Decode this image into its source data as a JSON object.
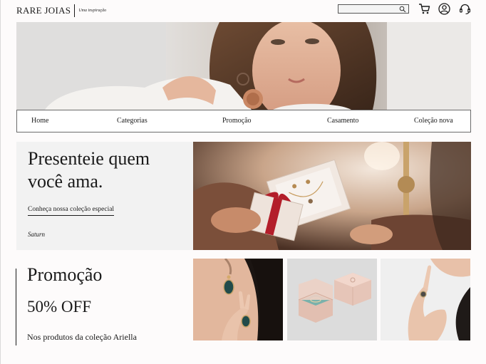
{
  "header": {
    "logo_main": "RARE JOIAS",
    "logo_tagline": "Uma inspiração",
    "search_value": "",
    "icons": [
      "search-icon",
      "cart-icon",
      "user-icon",
      "support-headset-icon"
    ]
  },
  "nav": {
    "items": [
      "Home",
      "Categorias",
      "Promoção",
      "Casamento",
      "Coleção nova"
    ]
  },
  "gift_promo": {
    "title": "Presenteie quem você ama.",
    "link": "Conheça nossa coleção especial",
    "brand": "Saturn"
  },
  "sale": {
    "title": "Promoção",
    "discount": "50% OFF",
    "subtitle": "Nos produtos da coleção Ariella"
  },
  "colors": {
    "background": "#fdfbfb",
    "panel": "#f2f2f2",
    "text": "#1a1a1a"
  }
}
